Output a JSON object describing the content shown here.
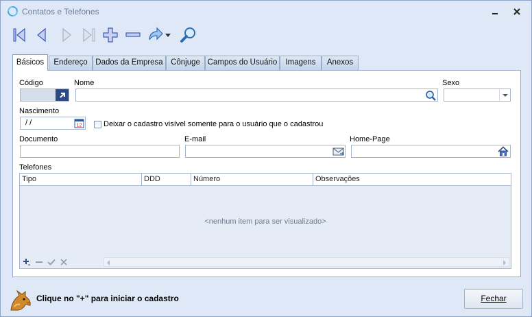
{
  "window": {
    "title": "Contatos e Telefones"
  },
  "toolbar": {
    "buttons": [
      "first",
      "previous",
      "next",
      "last",
      "add",
      "remove",
      "share",
      "search"
    ]
  },
  "tabs": [
    {
      "label": "Básicos",
      "active": true
    },
    {
      "label": "Endereço"
    },
    {
      "label": "Dados da Empresa"
    },
    {
      "label": "Cônjuge"
    },
    {
      "label": "Campos do Usuário"
    },
    {
      "label": "Imagens"
    },
    {
      "label": "Anexos"
    }
  ],
  "form": {
    "codigo_label": "Código",
    "codigo_value": "",
    "nome_label": "Nome",
    "nome_value": "",
    "sexo_label": "Sexo",
    "sexo_value": "",
    "nascimento_label": "Nascimento",
    "nascimento_value": " / /",
    "calendar_day": "12",
    "visible_checkbox_label": "Deixar o cadastro visível somente para o usuário que o cadastrou",
    "visible_checkbox_checked": false,
    "documento_label": "Documento",
    "documento_value": "",
    "email_label": "E-mail",
    "email_value": "",
    "homepage_label": "Home-Page",
    "homepage_value": ""
  },
  "phones": {
    "label": "Telefones",
    "columns": [
      "Tipo",
      "DDD",
      "Número",
      "Observações"
    ],
    "empty_message": "<nenhum item para ser visualizado>",
    "footer_buttons": [
      "add",
      "remove",
      "confirm",
      "cancel"
    ]
  },
  "status": {
    "message": "Clique no \"+\" para iniciar o cadastro",
    "close_label": "Fechar"
  },
  "colors": {
    "background": "#dfe8f6",
    "accent": "#4b73c9",
    "border": "#99acc7"
  }
}
